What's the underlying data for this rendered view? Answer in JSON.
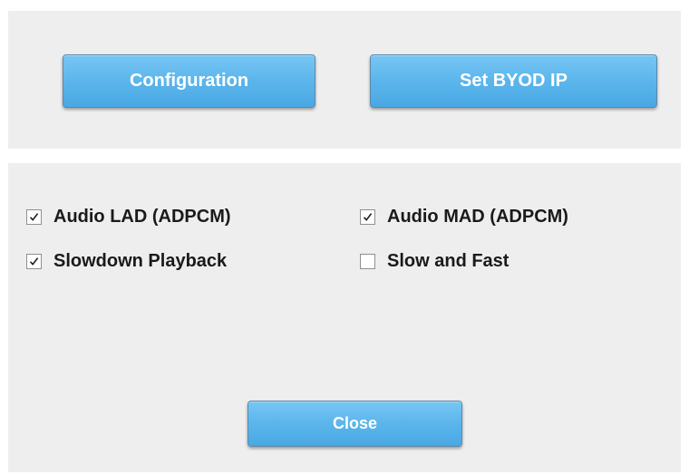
{
  "top_panel": {
    "configuration_label": "Configuration",
    "set_byod_ip_label": "Set BYOD IP"
  },
  "options": [
    {
      "label": "Audio LAD (ADPCM)",
      "checked": true
    },
    {
      "label": "Audio MAD (ADPCM)",
      "checked": true
    },
    {
      "label": "Slowdown Playback",
      "checked": true
    },
    {
      "label": "Slow and Fast",
      "checked": false
    }
  ],
  "footer": {
    "close_label": "Close"
  },
  "colors": {
    "panel_background": "#eeeeee",
    "button_blue": "#5cb6ec",
    "button_text": "#ffffff"
  },
  "icons": {
    "check": "checkmark-icon"
  }
}
